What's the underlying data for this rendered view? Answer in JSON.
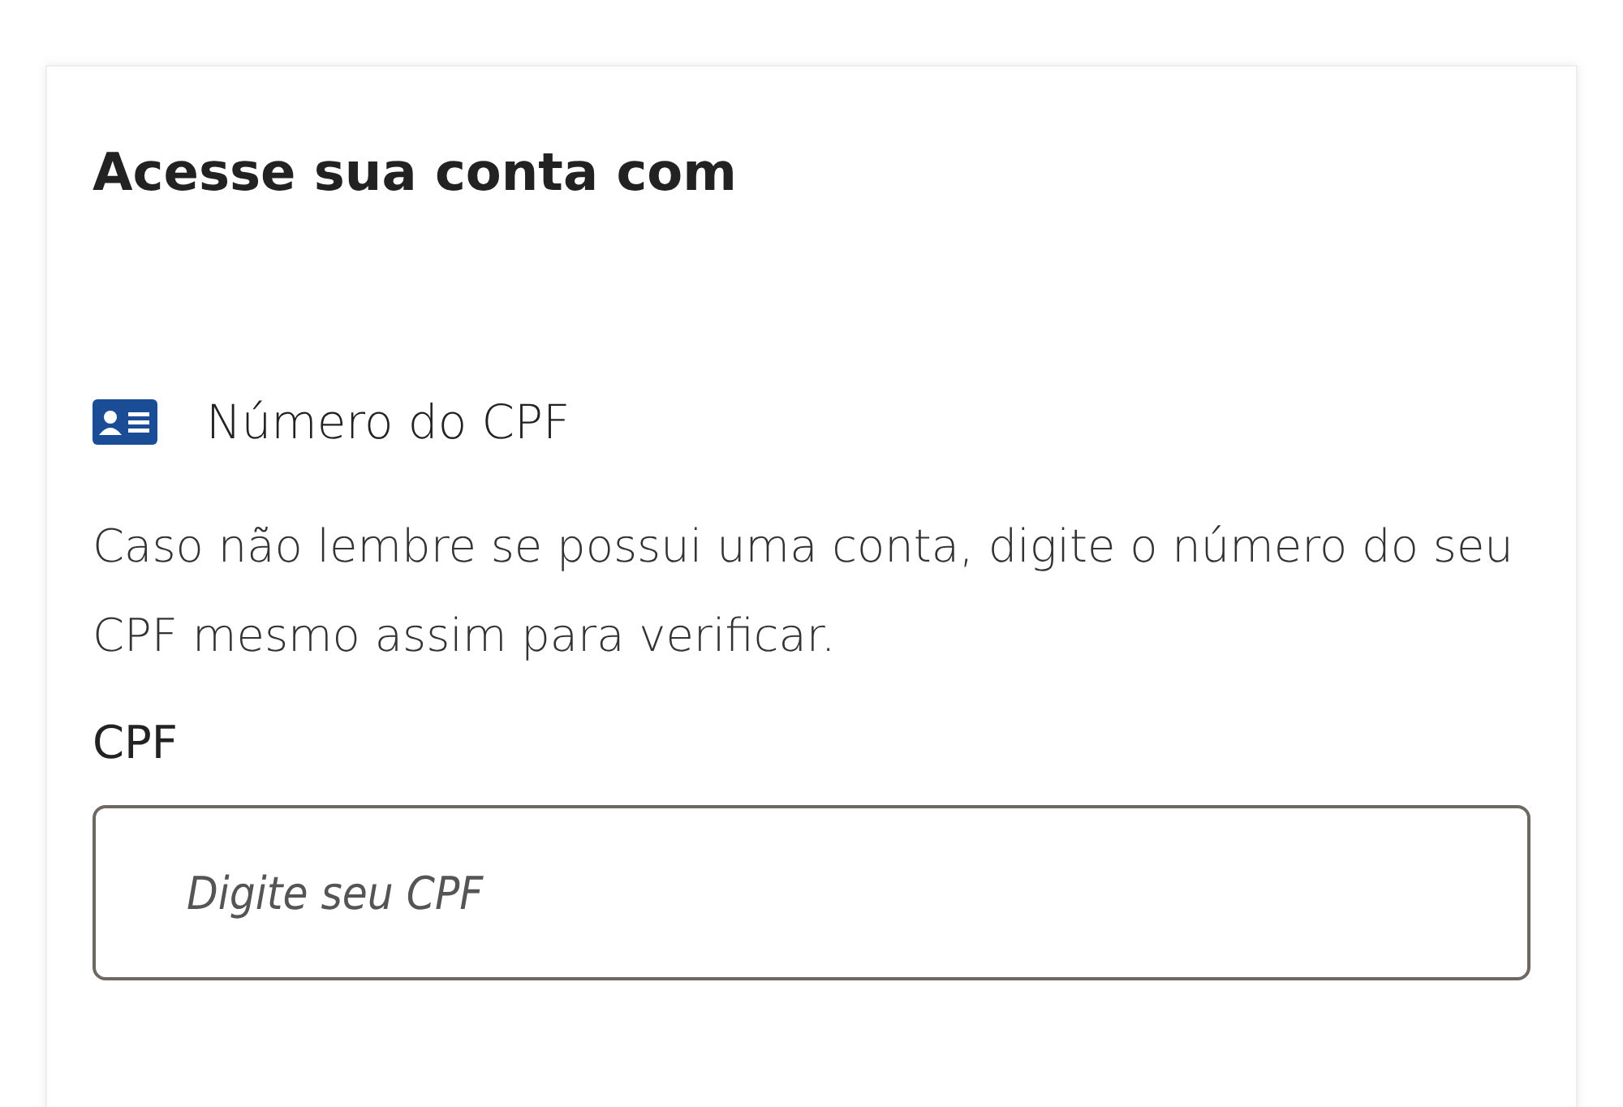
{
  "card": {
    "title": "Acesse sua conta com",
    "option": {
      "label": "Número do CPF"
    },
    "description": "Caso não lembre se possui uma conta, digite o número do seu CPF mesmo assim para verificar.",
    "field": {
      "label": "CPF",
      "placeholder": "Digite seu CPF"
    }
  }
}
